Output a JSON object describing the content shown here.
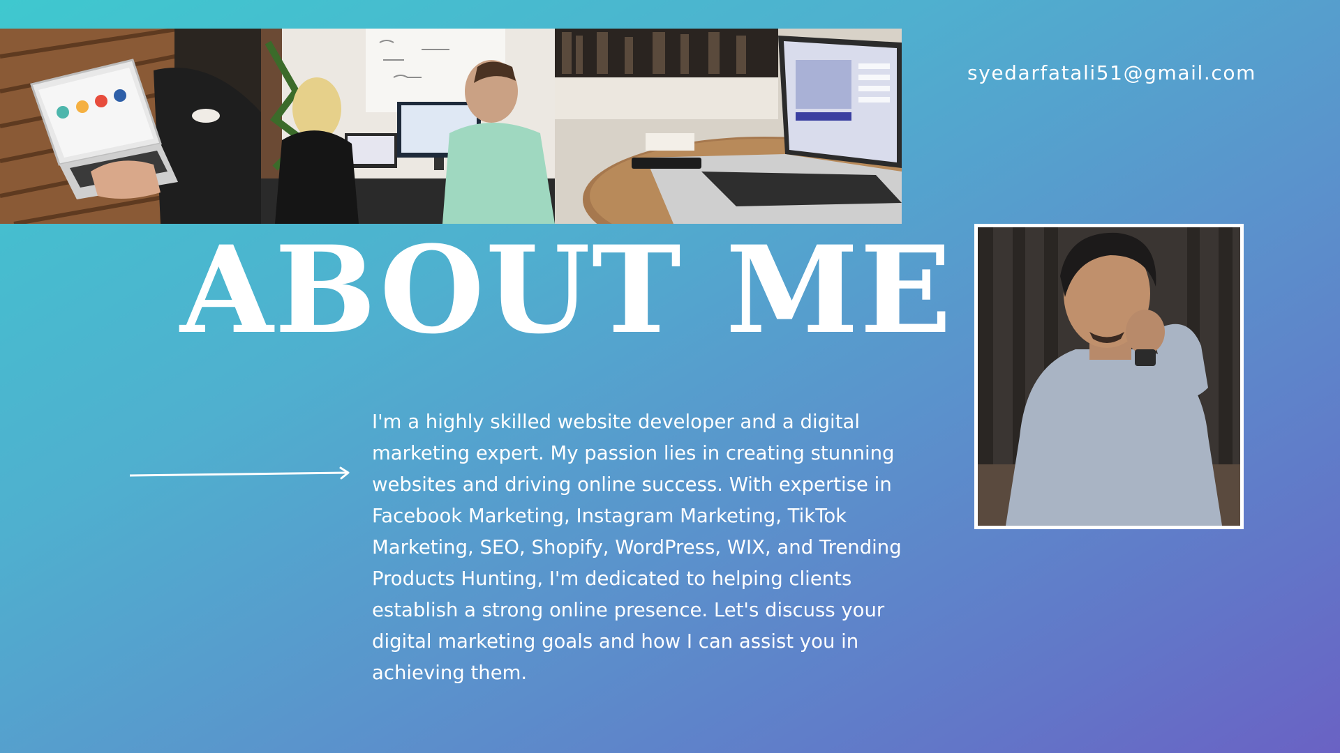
{
  "contact": {
    "email": "syedarfatali51@gmail.com"
  },
  "title": "ABOUT ME",
  "bio": "I'm a highly skilled website developer and a digital marketing expert. My passion lies in creating stunning websites and driving online success. With expertise in Facebook Marketing, Instagram Marketing, TikTok Marketing, SEO, Shopify, WordPress, WIX, and Trending Products Hunting, I'm dedicated to helping clients establish a strong online presence. Let's discuss your digital marketing goals and how I can assist you in achieving them.",
  "colors": {
    "gradient_start": "#3fc8cf",
    "gradient_end": "#6a62c4",
    "text": "#ffffff"
  },
  "images": [
    {
      "name": "photo-laptop-on-wooden-table"
    },
    {
      "name": "photo-team-at-computer-monitor"
    },
    {
      "name": "photo-laptop-on-round-table"
    },
    {
      "name": "portrait-photo"
    }
  ],
  "icons": {
    "arrow": "right-arrow-icon"
  }
}
